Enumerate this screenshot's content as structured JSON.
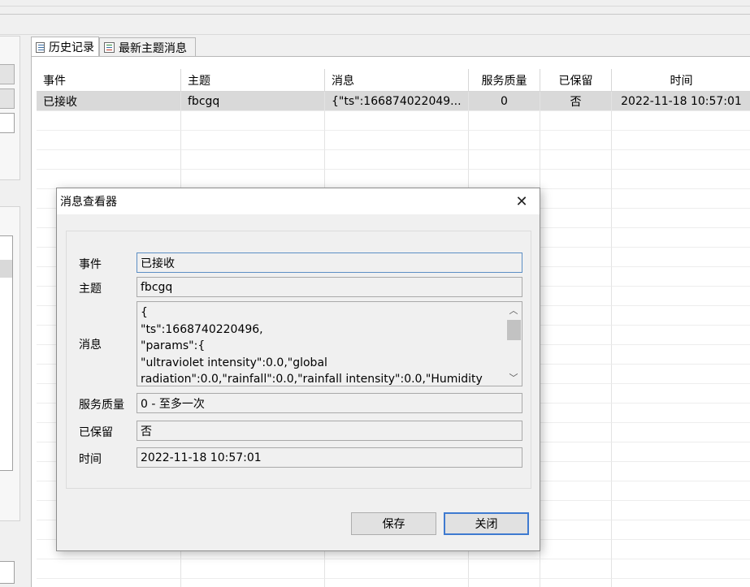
{
  "tabs": [
    {
      "label": "历史记录",
      "active": true
    },
    {
      "label": "最新主题消息",
      "active": false
    }
  ],
  "table": {
    "columns": [
      "事件",
      "主题",
      "消息",
      "服务质量",
      "已保留",
      "时间"
    ],
    "rows": [
      [
        "已接收",
        "fbcgq",
        "{\"ts\":166874022049...",
        "0",
        "否",
        "2022-11-18 10:57:01"
      ]
    ]
  },
  "dialog": {
    "title": "消息查看器",
    "close_glyph": "✕",
    "labels": {
      "event": "事件",
      "topic": "主题",
      "message": "消息",
      "qos": "服务质量",
      "retained": "已保留",
      "time": "时间"
    },
    "values": {
      "event": "已接收",
      "topic": "fbcgq",
      "qos": "0 - 至多一次",
      "retained": "否",
      "time": "2022-11-18 10:57:01"
    },
    "message_lines": [
      "{",
      "\"ts\":1668740220496,",
      "\"params\":{",
      "\"ultraviolet intensity\":0.0,\"global",
      "radiation\":0.0,\"rainfall\":0.0,\"rainfall intensity\":0.0,\"Humidity"
    ],
    "buttons": {
      "save": "保存",
      "close": "关闭"
    }
  },
  "colors": {
    "selection": "#d9d9d9",
    "default_button_border": "#3e7ad0",
    "focus_border": "#5c8ec4"
  }
}
